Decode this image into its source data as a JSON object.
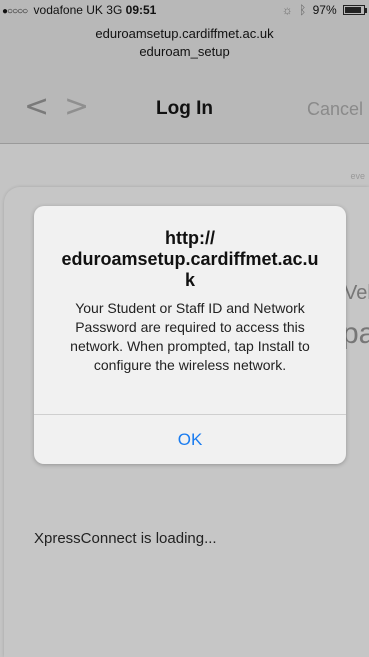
{
  "status_bar": {
    "signal_dots": "●○○○○",
    "carrier": "vodafone UK",
    "network": "3G",
    "time": "09:51",
    "battery_percent": "97%",
    "battery_level": 0.97
  },
  "header": {
    "url_line_1": "eduroamsetup.cardiffmet.ac.uk",
    "url_line_2": "eduroam_setup",
    "title": "Log In",
    "cancel_label": "Cancel"
  },
  "webview": {
    "edge_text": "eve",
    "peek_text_1": "Vel",
    "peek_text_2": "pa",
    "loading_text": "XpressConnect is loading..."
  },
  "alert": {
    "title": "http://\neduroamsetup.cardiffmet.ac.u\nk",
    "message": "Your Student or Staff ID and Network Password are required to access this network. When prompted, tap Install to configure the wireless network.",
    "ok_label": "OK"
  },
  "colors": {
    "link_blue": "#1a7cf0",
    "header_gray": "#b8b8b8",
    "dim_gray": "#c4c4c4"
  },
  "icons": [
    "back-chevron-icon",
    "forward-chevron-icon",
    "location-icon",
    "bluetooth-icon",
    "battery-icon"
  ]
}
